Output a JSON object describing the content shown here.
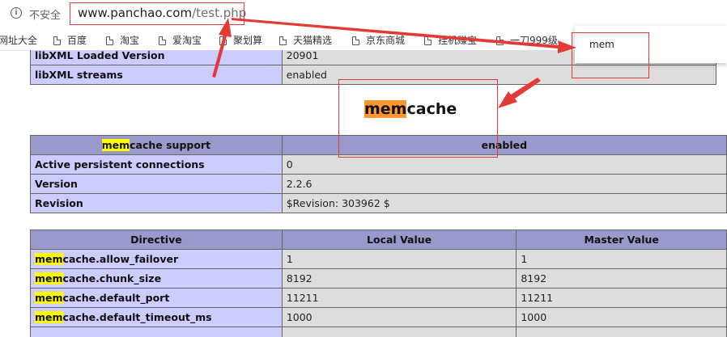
{
  "address_bar": {
    "security_label": "不安全",
    "url_host": "www.panchao.com",
    "url_path": "/test.php"
  },
  "bookmarks": [
    "网址大全",
    "百度",
    "淘宝",
    "爱淘宝",
    "聚划算",
    "天猫精选",
    "京东商城",
    "挂机赚宝",
    "一刀999级"
  ],
  "find_bar": {
    "query": "mem"
  },
  "libxml_rows": [
    {
      "label": "libXML Loaded Version",
      "value": "20901"
    },
    {
      "label": "libXML streams",
      "value": "enabled"
    }
  ],
  "section": {
    "title_highlight": "mem",
    "title_rest": "cache"
  },
  "support_table": {
    "header_highlight": "mem",
    "header_rest": "cache support",
    "header_value": "enabled",
    "rows": [
      {
        "label": "Active persistent connections",
        "value": "0"
      },
      {
        "label": "Version",
        "value": "2.2.6"
      },
      {
        "label": "Revision",
        "value": "$Revision: 303962 $"
      }
    ]
  },
  "directive_table": {
    "headers": [
      "Directive",
      "Local Value",
      "Master Value"
    ],
    "rows": [
      {
        "highlight": "mem",
        "rest": "cache.allow_failover",
        "local": "1",
        "master": "1"
      },
      {
        "highlight": "mem",
        "rest": "cache.chunk_size",
        "local": "8192",
        "master": "8192"
      },
      {
        "highlight": "mem",
        "rest": "cache.default_port",
        "local": "11211",
        "master": "11211"
      },
      {
        "highlight": "mem",
        "rest": "cache.default_timeout_ms",
        "local": "1000",
        "master": "1000"
      }
    ]
  },
  "annotation_color": "#e53935"
}
